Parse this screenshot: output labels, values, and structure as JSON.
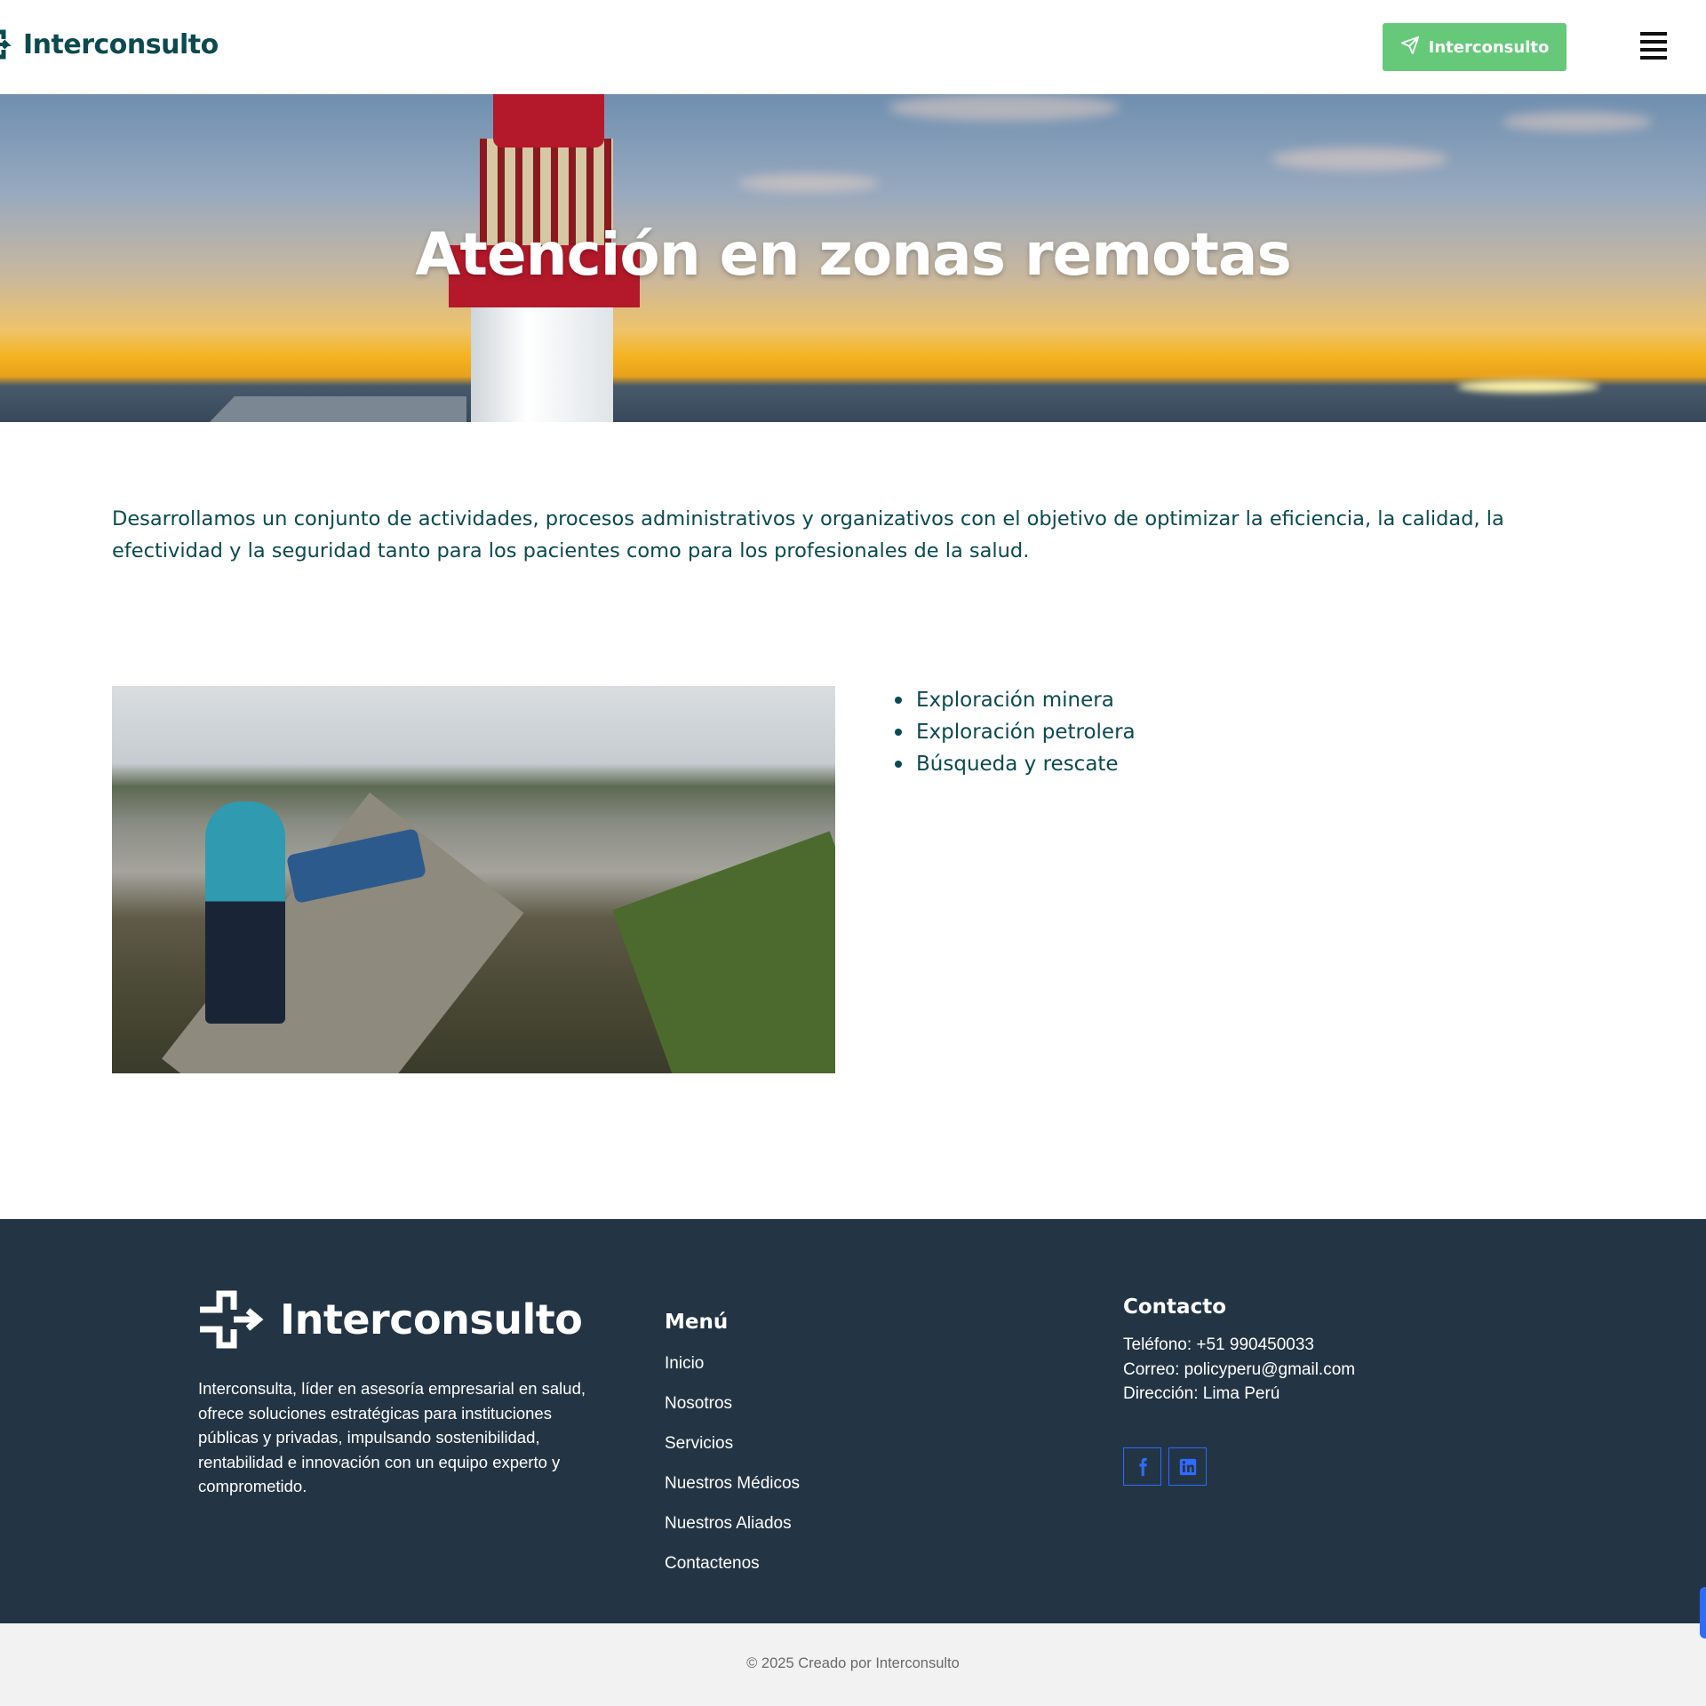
{
  "header": {
    "brand": "Interconsulto",
    "cta_label": "Interconsulto",
    "icons": {
      "cta": "send-icon",
      "menu": "hamburger-menu-icon"
    }
  },
  "hero": {
    "title": "Atención en zonas remotas"
  },
  "intro": {
    "text": "Desarrollamos un conjunto de actividades, procesos administrativos y organizativos con el objetivo de optimizar la eficiencia, la calidad, la efectividad y la seguridad tanto para los pacientes como para los profesionales de la salud."
  },
  "features": [
    "Exploración minera",
    "Exploración petrolera",
    "Búsqueda y rescate"
  ],
  "footer": {
    "brand": "Interconsulto",
    "about": "Interconsulta, líder en asesoría empresarial en salud, ofrece soluciones estratégicas para instituciones públicas y privadas, impulsando sostenibilidad, rentabilidad e innovación con un equipo experto y comprometido.",
    "menu_title": "Menú",
    "menu": [
      "Inicio",
      "Nosotros",
      "Servicios",
      "Nuestros Médicos",
      "Nuestros Aliados",
      "Contactenos"
    ],
    "contact_title": "Contacto",
    "contact": {
      "phone": "Teléfono: +51 990450033",
      "email": "Correo: policyperu@gmail.com",
      "address": "Dirección: Lima Perú"
    },
    "social": [
      "facebook-icon",
      "linkedin-icon"
    ]
  },
  "copyright": "© 2025 Creado por Interconsulto",
  "colors": {
    "brand_dark": "#0b4a4f",
    "cta_green": "#66c97a",
    "footer_bg": "#233444",
    "social_blue": "#2f6bff",
    "bottom_bar": "#f2f2f2"
  }
}
